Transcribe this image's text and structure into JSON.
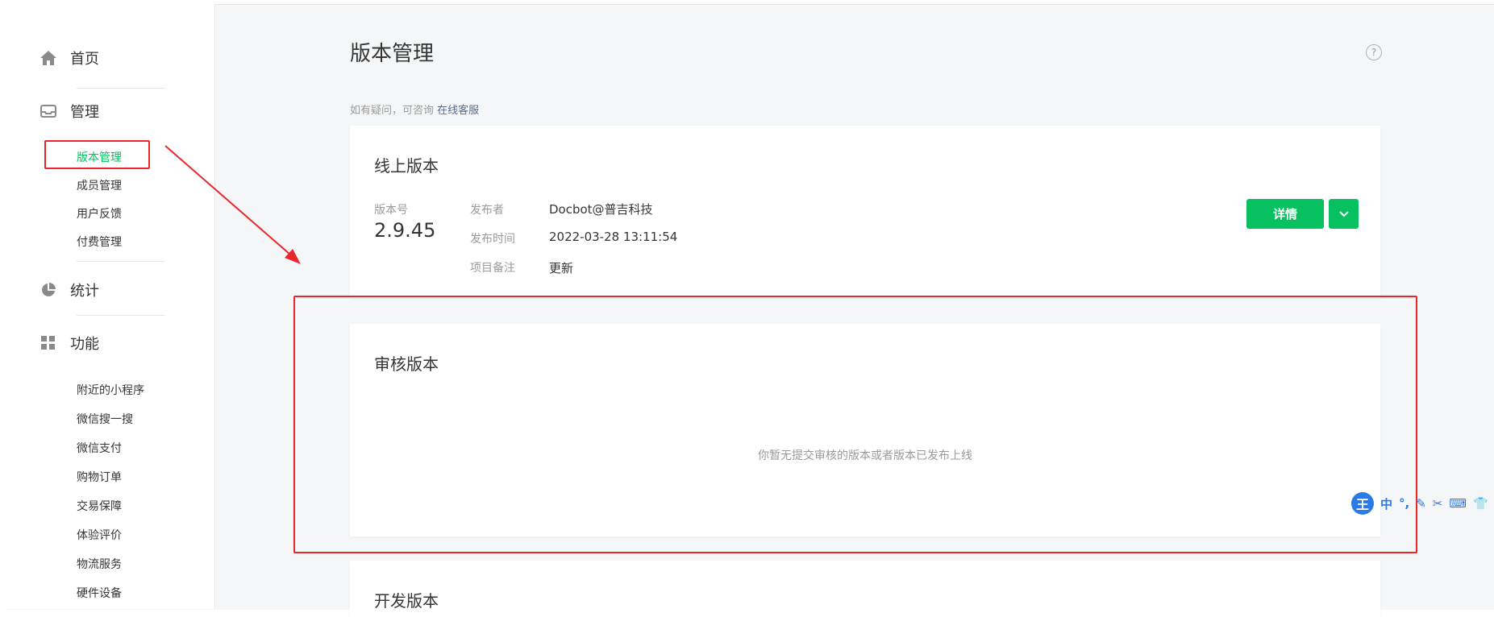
{
  "sidebar": {
    "home_label": "首页",
    "manage_label": "管理",
    "manage_items": [
      "版本管理",
      "成员管理",
      "用户反馈",
      "付费管理"
    ],
    "stats_label": "统计",
    "features_label": "功能",
    "feature_items": [
      "附近的小程序",
      "微信搜一搜",
      "微信支付",
      "购物订单",
      "交易保障",
      "体验评价",
      "物流服务",
      "硬件设备"
    ]
  },
  "main": {
    "page_title": "版本管理",
    "hint_text": "如有疑问，可咨询",
    "hint_link": "在线客服",
    "online": {
      "title": "线上版本",
      "version_label": "版本号",
      "version_value": "2.9.45",
      "publisher_label": "发布者",
      "publisher_value": "Docbot@普吉科技",
      "time_label": "发布时间",
      "time_value": "2022-03-28 13:11:54",
      "note_label": "项目备注",
      "note_value": "更新",
      "detail_button": "详情"
    },
    "review": {
      "title": "审核版本",
      "empty_text": "你暂无提交审核的版本或者版本已发布上线"
    },
    "dev": {
      "title": "开发版本"
    }
  },
  "ime": {
    "logo": "王",
    "mode": "中",
    "punct": "°,"
  },
  "colors": {
    "accent": "#07c160",
    "annotation": "#e8262b",
    "link": "#576b95"
  }
}
